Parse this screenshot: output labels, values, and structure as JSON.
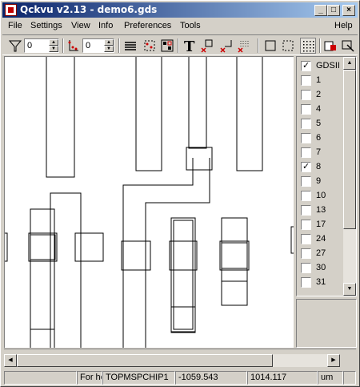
{
  "window": {
    "title": "Qckvu v2.13 - demo6.gds",
    "minimize": "_",
    "maximize": "□",
    "close": "×"
  },
  "menu": [
    "File",
    "Settings",
    "View",
    "Info",
    "Preferences",
    "Tools",
    "Help"
  ],
  "toolbar": {
    "filter_value": "0",
    "level_value": "0",
    "text_tool": "T"
  },
  "layers": {
    "items": [
      {
        "label": "GDSII",
        "checked": true
      },
      {
        "label": "1",
        "checked": false
      },
      {
        "label": "2",
        "checked": false
      },
      {
        "label": "4",
        "checked": false
      },
      {
        "label": "5",
        "checked": false
      },
      {
        "label": "6",
        "checked": false
      },
      {
        "label": "7",
        "checked": false
      },
      {
        "label": "8",
        "checked": true
      },
      {
        "label": "9",
        "checked": false
      },
      {
        "label": "10",
        "checked": false
      },
      {
        "label": "13",
        "checked": false
      },
      {
        "label": "17",
        "checked": false
      },
      {
        "label": "24",
        "checked": false
      },
      {
        "label": "27",
        "checked": false
      },
      {
        "label": "30",
        "checked": false
      },
      {
        "label": "31",
        "checked": false
      }
    ]
  },
  "status": {
    "hint": "For he",
    "cell": "TOPMSPCHIP1",
    "x": "-1059.543",
    "y": "1014.117",
    "units": "um"
  }
}
